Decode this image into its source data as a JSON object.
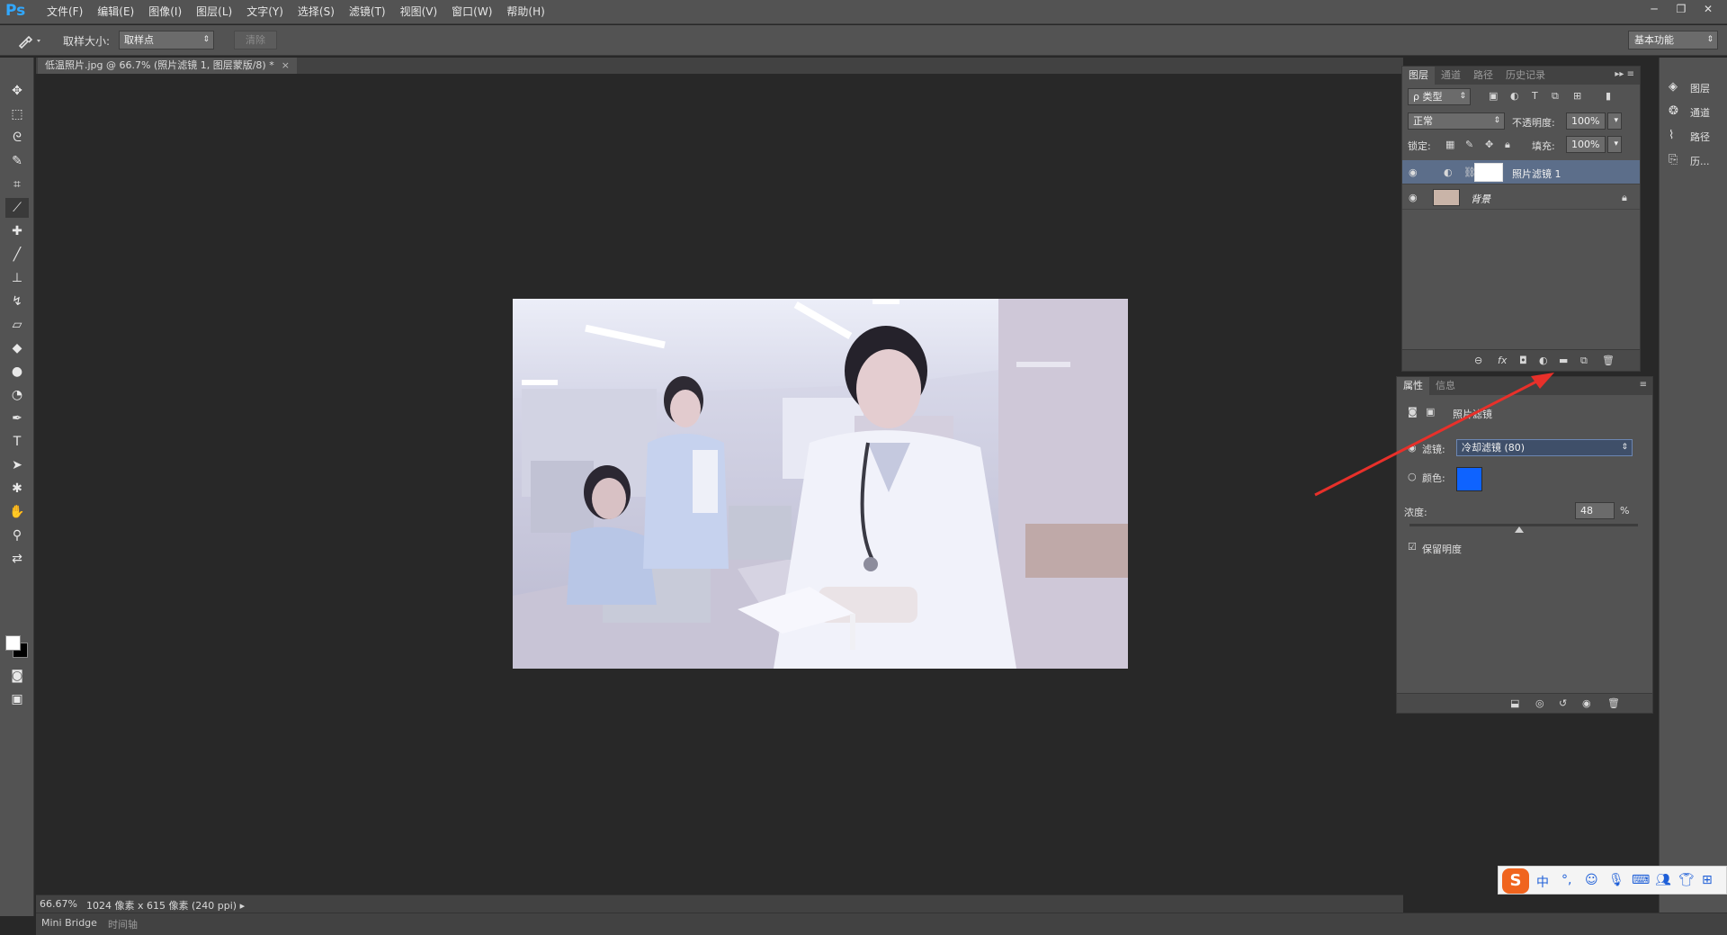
{
  "app": {
    "logo": "Ps"
  },
  "menu": [
    "文件(F)",
    "编辑(E)",
    "图像(I)",
    "图层(L)",
    "文字(Y)",
    "选择(S)",
    "滤镜(T)",
    "视图(V)",
    "窗口(W)",
    "帮助(H)"
  ],
  "window_controls": {
    "minimize": "─",
    "restore": "❐",
    "close": "✕"
  },
  "options": {
    "tool_icon": "eyedropper-icon",
    "sample_size_label": "取样大小:",
    "sample_size_value": "取样点",
    "clear_label": "清除",
    "workspace_value": "基本功能"
  },
  "document": {
    "tab_title": "低温照片.jpg @ 66.7% (照片滤镜 1, 图层蒙版/8) *",
    "close": "×"
  },
  "status": {
    "zoom": "66.67%",
    "info": "1024 像素 x 615 像素 (240 ppi)"
  },
  "bottom_tabs": [
    "Mini Bridge",
    "时间轴"
  ],
  "layers_panel": {
    "tabs": [
      "图层",
      "通道",
      "路径",
      "历史记录"
    ],
    "filter_kind": "ρ 类型",
    "blend_mode": "正常",
    "opacity_label": "不透明度:",
    "opacity_value": "100%",
    "lock_label": "锁定:",
    "fill_label": "填充:",
    "fill_value": "100%",
    "layers": [
      {
        "name": "照片滤镜 1",
        "selected": true
      },
      {
        "name": "背景",
        "selected": false,
        "locked": true
      }
    ],
    "footer_icons": [
      "link-icon",
      "fx-icon",
      "mask-icon",
      "adjustment-icon",
      "folder-icon",
      "new-layer-icon",
      "trash-icon"
    ]
  },
  "properties_panel": {
    "tabs": [
      "属性",
      "信息"
    ],
    "title": "照片滤镜",
    "filter_label": "滤镜:",
    "filter_value": "冷却滤镜 (80)",
    "color_label": "颜色:",
    "color_value": "#0e63ff",
    "density_label": "浓度:",
    "density_value": "48",
    "density_unit": "%",
    "density_fraction": 0.48,
    "preserve_label": "保留明度",
    "preserve_checked": true
  },
  "dock": [
    {
      "icon": "layers-icon",
      "label": "图层"
    },
    {
      "icon": "channels-icon",
      "label": "通道"
    },
    {
      "icon": "paths-icon",
      "label": "路径"
    },
    {
      "icon": "history-icon",
      "label": "历..."
    }
  ],
  "ime": {
    "logo": "S",
    "mode": "中"
  },
  "colors": {
    "annotation_arrow": "#e8302a",
    "accent": "#31a8ff"
  }
}
